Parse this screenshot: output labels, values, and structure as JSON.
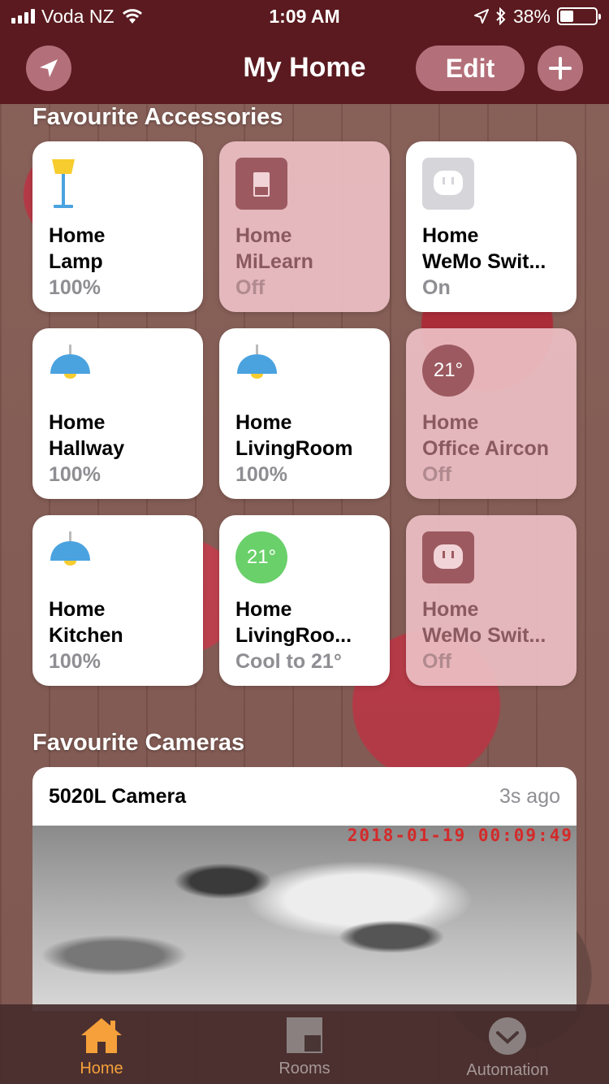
{
  "status_bar": {
    "carrier": "Voda NZ",
    "time": "1:09 AM",
    "battery": "38%",
    "battery_level": 0.38
  },
  "nav": {
    "title": "My Home",
    "edit_label": "Edit"
  },
  "accessories": {
    "title": "Favourite Accessories",
    "tiles": [
      {
        "line1": "Home",
        "line2": "Lamp",
        "status": "100%",
        "state": "on",
        "icon": "floor-lamp-icon"
      },
      {
        "line1": "Home",
        "line2": "MiLearn",
        "status": "Off",
        "state": "off",
        "icon": "switch-icon"
      },
      {
        "line1": "Home",
        "line2": "WeMo Swit...",
        "status": "On",
        "state": "on",
        "icon": "outlet-icon"
      },
      {
        "line1": "Home",
        "line2": "Hallway",
        "status": "100%",
        "state": "on",
        "icon": "pendant-light-icon"
      },
      {
        "line1": "Home",
        "line2": "LivingRoom",
        "status": "100%",
        "state": "on",
        "icon": "pendant-light-icon"
      },
      {
        "line1": "Home",
        "line2": "Office Aircon",
        "status": "Off",
        "state": "off",
        "icon": "thermostat-icon",
        "temp": "21°"
      },
      {
        "line1": "Home",
        "line2": "Kitchen",
        "status": "100%",
        "state": "on",
        "icon": "pendant-light-icon"
      },
      {
        "line1": "Home",
        "line2": "LivingRoo...",
        "status": "Cool to 21°",
        "state": "on",
        "icon": "thermostat-icon",
        "temp": "21°"
      },
      {
        "line1": "Home",
        "line2": "WeMo Swit...",
        "status": "Off",
        "state": "off",
        "icon": "outlet-icon"
      }
    ]
  },
  "cameras": {
    "title": "Favourite Cameras",
    "name": "5020L Camera",
    "time_ago": "3s ago",
    "stamp": "2018-01-19 00:09:49"
  },
  "tabs": [
    {
      "label": "Home",
      "active": true
    },
    {
      "label": "Rooms",
      "active": false
    },
    {
      "label": "Automation",
      "active": false
    }
  ],
  "colors": {
    "accent": "#f5a03a",
    "thermostat_on": "#6ad06a",
    "thermostat_off": "#9c5a60",
    "light_blue": "#4aa3df",
    "lamp_yellow": "#f7cc2e"
  }
}
